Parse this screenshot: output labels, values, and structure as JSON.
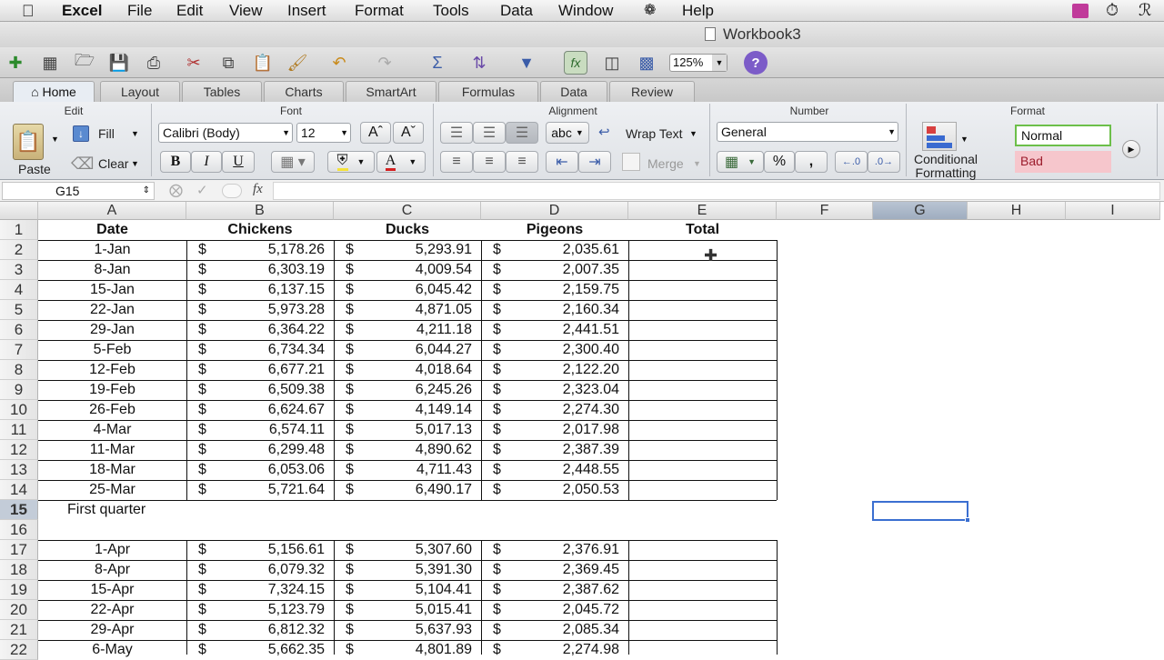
{
  "menubar": {
    "apple": "",
    "items": [
      "Excel",
      "File",
      "Edit",
      "View",
      "Insert",
      "Format",
      "Tools",
      "Data",
      "Window",
      "Help"
    ]
  },
  "window": {
    "title": "Workbook3"
  },
  "toolbar": {
    "zoom": "125%"
  },
  "ribbon": {
    "tabs": [
      "Home",
      "Layout",
      "Tables",
      "Charts",
      "SmartArt",
      "Formulas",
      "Data",
      "Review"
    ],
    "active_tab": "Home",
    "groups": {
      "edit": "Edit",
      "font": "Font",
      "alignment": "Alignment",
      "number": "Number",
      "format": "Format"
    },
    "edit": {
      "paste": "Paste",
      "fill": "Fill",
      "clear": "Clear"
    },
    "font": {
      "name": "Calibri (Body)",
      "size": "12",
      "bold": "B",
      "italic": "I",
      "underline": "U",
      "font_color": "A"
    },
    "alignment": {
      "abc": "abc",
      "wrap_text": "Wrap Text",
      "merge": "Merge"
    },
    "number": {
      "format": "General",
      "percent": "%",
      "comma": ","
    },
    "format": {
      "conditional_line1": "Conditional",
      "conditional_line2": "Formatting",
      "style_normal": "Normal",
      "style_bad": "Bad"
    }
  },
  "formula_bar": {
    "name_box": "G15",
    "fx": "fx",
    "value": ""
  },
  "sheet": {
    "columns": [
      "A",
      "B",
      "C",
      "D",
      "E",
      "F",
      "G",
      "H",
      "I"
    ],
    "selected_column": "G",
    "selected_row": "15",
    "headers": {
      "date": "Date",
      "chickens": "Chickens",
      "ducks": "Ducks",
      "pigeons": "Pigeons",
      "total": "Total"
    },
    "currency": "$",
    "rows": [
      {
        "row": "1",
        "type": "header"
      },
      {
        "row": "2",
        "date": "1-Jan",
        "chickens": "5,178.26",
        "ducks": "5,293.91",
        "pigeons": "2,035.61"
      },
      {
        "row": "3",
        "date": "8-Jan",
        "chickens": "6,303.19",
        "ducks": "4,009.54",
        "pigeons": "2,007.35"
      },
      {
        "row": "4",
        "date": "15-Jan",
        "chickens": "6,137.15",
        "ducks": "6,045.42",
        "pigeons": "2,159.75"
      },
      {
        "row": "5",
        "date": "22-Jan",
        "chickens": "5,973.28",
        "ducks": "4,871.05",
        "pigeons": "2,160.34"
      },
      {
        "row": "6",
        "date": "29-Jan",
        "chickens": "6,364.22",
        "ducks": "4,211.18",
        "pigeons": "2,441.51"
      },
      {
        "row": "7",
        "date": "5-Feb",
        "chickens": "6,734.34",
        "ducks": "6,044.27",
        "pigeons": "2,300.40"
      },
      {
        "row": "8",
        "date": "12-Feb",
        "chickens": "6,677.21",
        "ducks": "4,018.64",
        "pigeons": "2,122.20"
      },
      {
        "row": "9",
        "date": "19-Feb",
        "chickens": "6,509.38",
        "ducks": "6,245.26",
        "pigeons": "2,323.04"
      },
      {
        "row": "10",
        "date": "26-Feb",
        "chickens": "6,624.67",
        "ducks": "4,149.14",
        "pigeons": "2,274.30"
      },
      {
        "row": "11",
        "date": "4-Mar",
        "chickens": "6,574.11",
        "ducks": "5,017.13",
        "pigeons": "2,017.98"
      },
      {
        "row": "12",
        "date": "11-Mar",
        "chickens": "6,299.48",
        "ducks": "4,890.62",
        "pigeons": "2,387.39"
      },
      {
        "row": "13",
        "date": "18-Mar",
        "chickens": "6,053.06",
        "ducks": "4,711.43",
        "pigeons": "2,448.55"
      },
      {
        "row": "14",
        "date": "25-Mar",
        "chickens": "5,721.64",
        "ducks": "6,490.17",
        "pigeons": "2,050.53"
      },
      {
        "row": "15",
        "type": "label",
        "text": "First quarter"
      },
      {
        "row": "16",
        "type": "empty"
      },
      {
        "row": "17",
        "date": "1-Apr",
        "chickens": "5,156.61",
        "ducks": "5,307.60",
        "pigeons": "2,376.91"
      },
      {
        "row": "18",
        "date": "8-Apr",
        "chickens": "6,079.32",
        "ducks": "5,391.30",
        "pigeons": "2,369.45"
      },
      {
        "row": "19",
        "date": "15-Apr",
        "chickens": "7,324.15",
        "ducks": "5,104.41",
        "pigeons": "2,387.62"
      },
      {
        "row": "20",
        "date": "22-Apr",
        "chickens": "5,123.79",
        "ducks": "5,015.41",
        "pigeons": "2,045.72"
      },
      {
        "row": "21",
        "date": "29-Apr",
        "chickens": "6,812.32",
        "ducks": "5,637.93",
        "pigeons": "2,085.34"
      },
      {
        "row": "22",
        "date": "6-May",
        "chickens": "5,662.35",
        "ducks": "4,801.89",
        "pigeons": "2,274.98"
      }
    ]
  },
  "colors": {
    "accent": "#3b6fd1",
    "style_normal_border": "#6cbf4a",
    "style_bad_bg": "#f6c6cc",
    "style_bad_text": "#9c1c2c"
  }
}
